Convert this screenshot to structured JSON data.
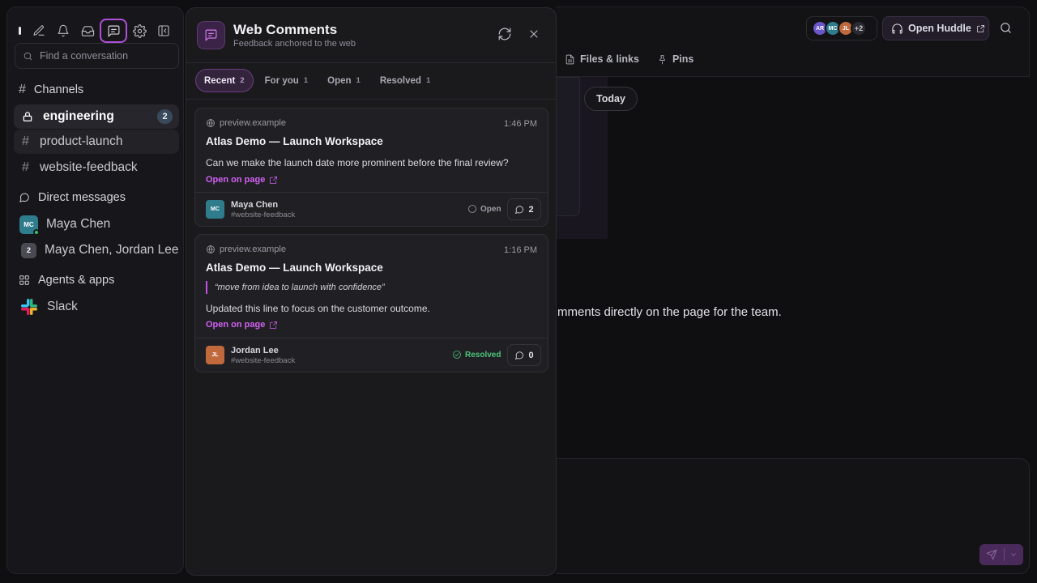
{
  "sidebar": {
    "search_placeholder": "Find a conversation",
    "channels_label": "Channels",
    "channels": [
      {
        "name": "engineering",
        "badge": "2"
      },
      {
        "name": "product-launch"
      },
      {
        "name": "website-feedback"
      }
    ],
    "dm_label": "Direct messages",
    "dms": [
      {
        "name": "Maya Chen",
        "initials": "MC"
      },
      {
        "name": "Maya Chen, Jordan Lee",
        "count": "2"
      }
    ],
    "apps_label": "Agents & apps",
    "apps": [
      {
        "name": "Slack"
      }
    ]
  },
  "header": {
    "facepile": [
      "AR",
      "MC",
      "JL"
    ],
    "facepile_more": "+2",
    "huddle_label": "Open Huddle",
    "tabs": [
      "Files & links",
      "Pins"
    ]
  },
  "main": {
    "today_label": "Today",
    "body_text": "mments directly on the page for the team."
  },
  "panel": {
    "title": "Web Comments",
    "subtitle": "Feedback anchored to the web",
    "tabs": [
      {
        "label": "Recent",
        "count": "2"
      },
      {
        "label": "For you",
        "count": "1"
      },
      {
        "label": "Open",
        "count": "1"
      },
      {
        "label": "Resolved",
        "count": "1"
      }
    ],
    "cards": [
      {
        "host": "preview.example",
        "time": "1:46 PM",
        "title": "Atlas Demo — Launch Workspace",
        "body": "Can we make the launch date more prominent before the final review?",
        "link": "Open on page",
        "author": "Maya Chen",
        "initials": "MC",
        "channel": "#website-feedback",
        "status": "Open",
        "replies": "2"
      },
      {
        "host": "preview.example",
        "time": "1:16 PM",
        "title": "Atlas Demo — Launch Workspace",
        "quote": "“move from idea to launch with confidence”",
        "body": "Updated this line to focus on the customer outcome.",
        "link": "Open on page",
        "author": "Jordan Lee",
        "initials": "JL",
        "channel": "#website-feedback",
        "status": "Resolved",
        "replies": "0"
      }
    ]
  },
  "colors": {
    "accent": "#c450e8",
    "resolved": "#4cc47a",
    "avatar_mc": "#2f7d8c",
    "avatar_jl": "#c0693c",
    "avatar_ar": "#6a55c9"
  }
}
